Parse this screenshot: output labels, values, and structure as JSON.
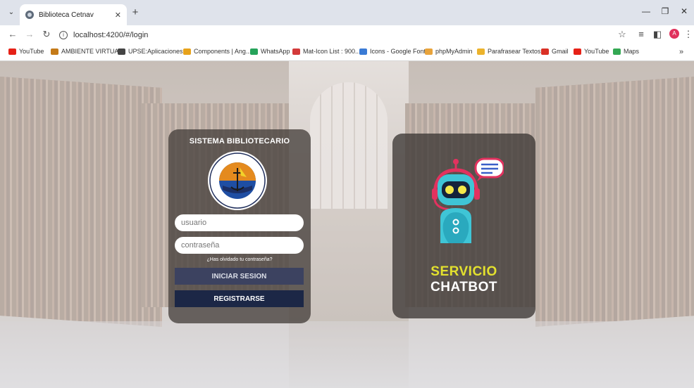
{
  "browser": {
    "tab_title": "Biblioteca Cetnav",
    "url": "localhost:4200/#/login",
    "profile_initial": "A",
    "bookmarks": [
      {
        "label": "YouTube",
        "color": "#e62117"
      },
      {
        "label": "AMBIENTE VIRTUA...",
        "color": "#c47a18"
      },
      {
        "label": "UPSE:Aplicaciones...",
        "color": "#444444"
      },
      {
        "label": "Components | Ang...",
        "color": "#e7a21b"
      },
      {
        "label": "WhatsApp",
        "color": "#25a35a"
      },
      {
        "label": "Mat-Icon List : 900...",
        "color": "#d33a3a"
      },
      {
        "label": "Icons - Google Fonts",
        "color": "#3a7bd5"
      },
      {
        "label": "phpMyAdmin",
        "color": "#e8a33b"
      },
      {
        "label": "Parafrasear Textos...",
        "color": "#ecb32c"
      },
      {
        "label": "Gmail",
        "color": "#d93025"
      },
      {
        "label": "YouTube",
        "color": "#e62117"
      },
      {
        "label": "Maps",
        "color": "#34a853"
      }
    ]
  },
  "login": {
    "title": "SISTEMA BIBLIOTECARIO",
    "logo_text_top": "ARMADA DEL ECUADOR",
    "logo_text_bottom": "CENTRO TECNOLOGICO NAVAL",
    "username_placeholder": "usuario",
    "password_placeholder": "contraseña",
    "forgot_password": "¿Has olvidado tu contraseña?",
    "login_button": "INICIAR SESION",
    "register_button": "REGISTRARSE"
  },
  "chatbot": {
    "line1": "SERVICIO",
    "line2": "CHATBOT"
  },
  "colors": {
    "accent_yellow": "#e3e12e",
    "register_button": "#1c2746",
    "login_button": "#3c4260"
  }
}
